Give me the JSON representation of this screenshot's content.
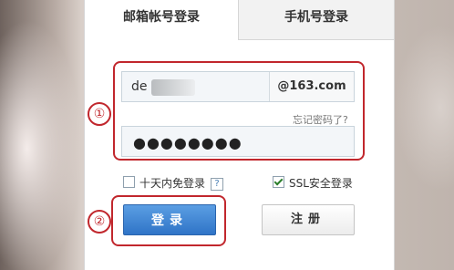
{
  "tabs": {
    "active": "邮箱帐号登录",
    "inactive": "手机号登录"
  },
  "username": {
    "value": "de",
    "domain": "@163.com"
  },
  "forgot_password": "忘记密码了?",
  "password": {
    "masked_value": "●●●●●●●●"
  },
  "options": {
    "remember_label": "十天内免登录",
    "remember_checked": false,
    "help_symbol": "?",
    "ssl_label": "SSL安全登录",
    "ssl_checked": true
  },
  "buttons": {
    "login": "登录",
    "register": "注册"
  },
  "annotations": {
    "marker_1": "①",
    "marker_2": "②"
  },
  "colors": {
    "annotation_red": "#c1272d",
    "login_blue": "#2f74c7"
  }
}
